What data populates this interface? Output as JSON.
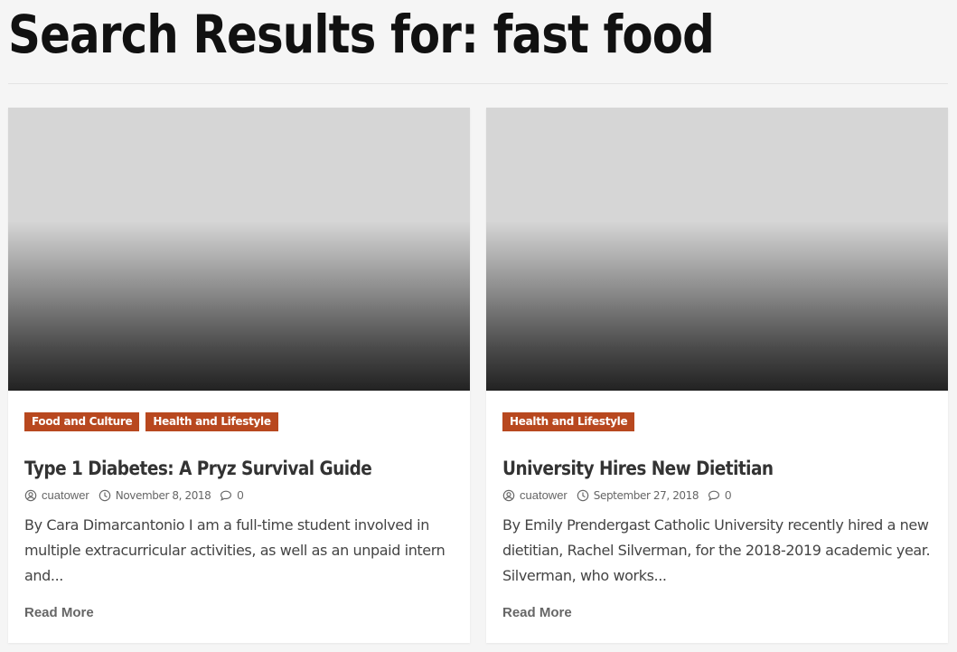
{
  "page": {
    "title": "Search Results for: fast food"
  },
  "posts": [
    {
      "categories": [
        "Food and Culture",
        "Health and Lifestyle"
      ],
      "title": "Type 1 Diabetes: A Pryz Survival Guide",
      "author": "cuatower",
      "date": "November 8, 2018",
      "comments": "0",
      "excerpt": "By Cara Dimarcantonio I am a full-time student involved in multiple extracurricular activities, as well as an unpaid intern and...",
      "read_more": "Read More"
    },
    {
      "categories": [
        "Health and Lifestyle"
      ],
      "title": "University Hires New Dietitian",
      "author": "cuatower",
      "date": "September 27, 2018",
      "comments": "0",
      "excerpt": "By Emily Prendergast Catholic University recently hired a new dietitian, Rachel Silverman, for the 2018-2019 academic year. Silverman, who works...",
      "read_more": "Read More"
    }
  ],
  "icons": {
    "author": "user-circle-icon",
    "date": "clock-icon",
    "comments": "comment-bubble-icon"
  },
  "colors": {
    "category_badge": "#b8481f",
    "background": "#f5f5f5"
  }
}
